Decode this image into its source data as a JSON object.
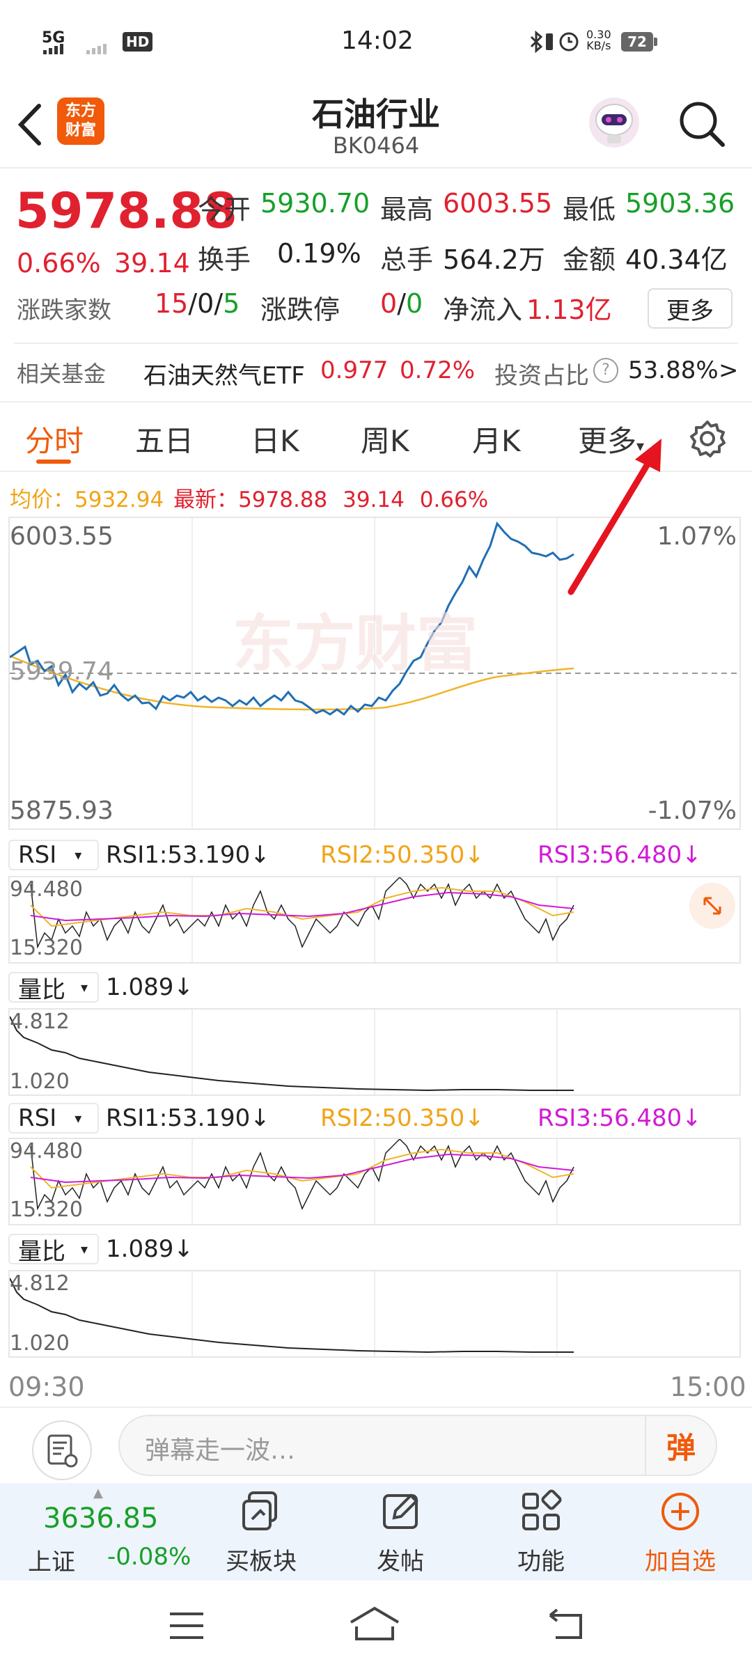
{
  "status_bar": {
    "time": "14:02",
    "network": "5G",
    "hd": "HD",
    "speed": "0.30",
    "speed_unit": "KB/s",
    "battery": "72"
  },
  "header": {
    "title": "石油行业",
    "code": "BK0464",
    "logo_text_1": "东方",
    "logo_text_2": "财富"
  },
  "quote": {
    "price": "5978.88",
    "change_pct": "0.66%",
    "change_val": "39.14",
    "open_label": "今开",
    "open": "5930.70",
    "high_label": "最高",
    "high": "6003.55",
    "low_label": "最低",
    "low": "5903.36",
    "turnover_label": "换手",
    "turnover": "0.19%",
    "volume_label": "总手",
    "volume": "564.2万",
    "amount_label": "金额",
    "amount": "40.34亿",
    "updown_label": "涨跌家数",
    "up": "15",
    "flat": "0",
    "down": "5",
    "sep": "/",
    "limit_label": "涨跌停",
    "limit_up": "0",
    "limit_down": "0",
    "inflow_label": "净流入",
    "inflow": "1.13亿",
    "more_btn": "更多"
  },
  "fund": {
    "label": "相关基金",
    "name": "石油天然气ETF",
    "price": "0.977",
    "pct": "0.72%",
    "ratio_label": "投资占比",
    "help": "?",
    "ratio": "53.88%",
    "arrow": ">"
  },
  "tabs": {
    "items": [
      "分时",
      "五日",
      "日K",
      "周K",
      "月K",
      "更多"
    ],
    "more_caret": "▾"
  },
  "info_line": {
    "avg_label": "均价：",
    "avg": "5932.94",
    "latest_label": "最新：",
    "latest": "5978.88",
    "change": "39.14",
    "pct": "0.66%"
  },
  "price_chart": {
    "top": "6003.55",
    "mid": "5939.74",
    "bottom": "5875.93",
    "top_pct": "1.07%",
    "bottom_pct": "-1.07%",
    "watermark": "东方财富"
  },
  "rsi": {
    "name": "RSI",
    "caret": "▾",
    "rsi1": "RSI1:53.190",
    "rsi2": "RSI2:50.350",
    "rsi3": "RSI3:56.480",
    "down_arrow": "↓",
    "max": "94.480",
    "min": "15.320"
  },
  "ratio": {
    "name": "量比",
    "caret": "▾",
    "value": "1.089",
    "down_arrow": "↓",
    "max": "4.812",
    "min": "1.020"
  },
  "time_axis": {
    "start": "09:30",
    "end": "15:00"
  },
  "danmu": {
    "placeholder": "弹幕走一波…",
    "btn": "弹"
  },
  "bottom_nav": {
    "index_value": "3636.85",
    "index_name": "上证",
    "index_pct": "-0.08%",
    "items": [
      "买板块",
      "发帖",
      "功能",
      "加自选"
    ]
  },
  "colors": {
    "red": "#e0212f",
    "green": "#16a028",
    "accent": "#f05a0a",
    "price_line": "#1f6fb5",
    "avg_line": "#f0b429"
  }
}
